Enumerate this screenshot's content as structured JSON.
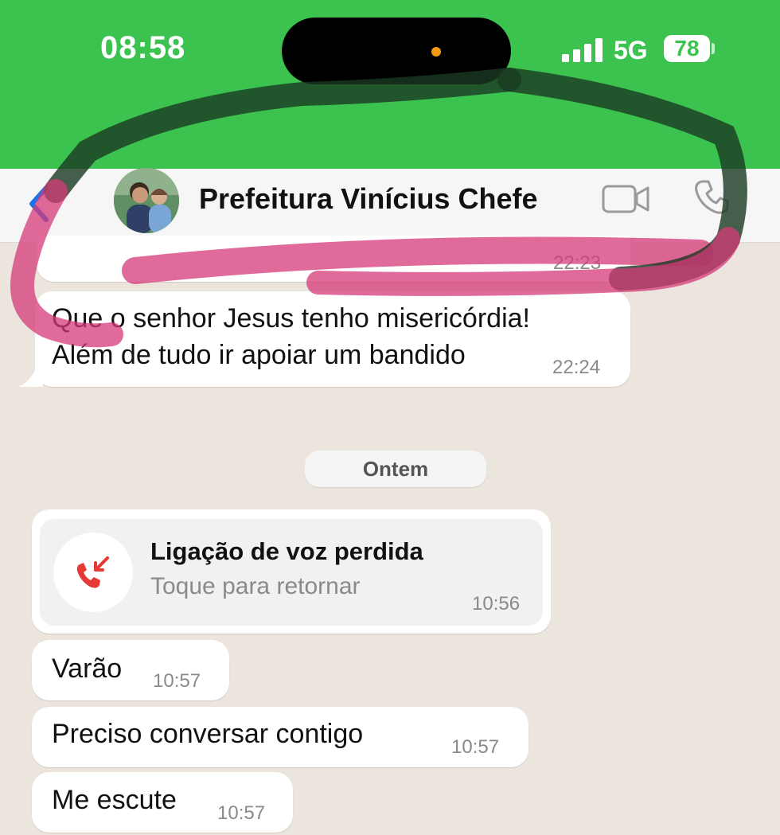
{
  "status_bar": {
    "time": "08:58",
    "network": "5G",
    "battery": "78"
  },
  "header": {
    "contact_name": "Prefeitura Vinícius Chefe",
    "back_icon": "chevron-left-icon",
    "video_icon": "video-camera-icon",
    "call_icon": "phone-icon"
  },
  "messages_top": {
    "partial_time": "22:23",
    "message_1": {
      "line_1": "Que o senhor Jesus tenho misericórdia!",
      "line_2": "Além de tudo ir apoiar um bandido",
      "time": "22:24"
    }
  },
  "date_separator": "Ontem",
  "missed_call": {
    "title": "Ligação de voz perdida",
    "subtitle": "Toque para retornar",
    "time": "10:56",
    "icon": "missed-call-icon"
  },
  "messages": [
    {
      "text": "Varão",
      "time": "10:57"
    },
    {
      "text": "Preciso conversar contigo",
      "time": "10:57"
    },
    {
      "text": "Me escute",
      "time": "10:57"
    }
  ],
  "colors": {
    "status_green": "#3cc34f",
    "ios_blue": "#1a73e8",
    "missed_red": "#e53935",
    "annotation_pink": "#d63a78",
    "annotation_dark": "#1a3a22"
  }
}
